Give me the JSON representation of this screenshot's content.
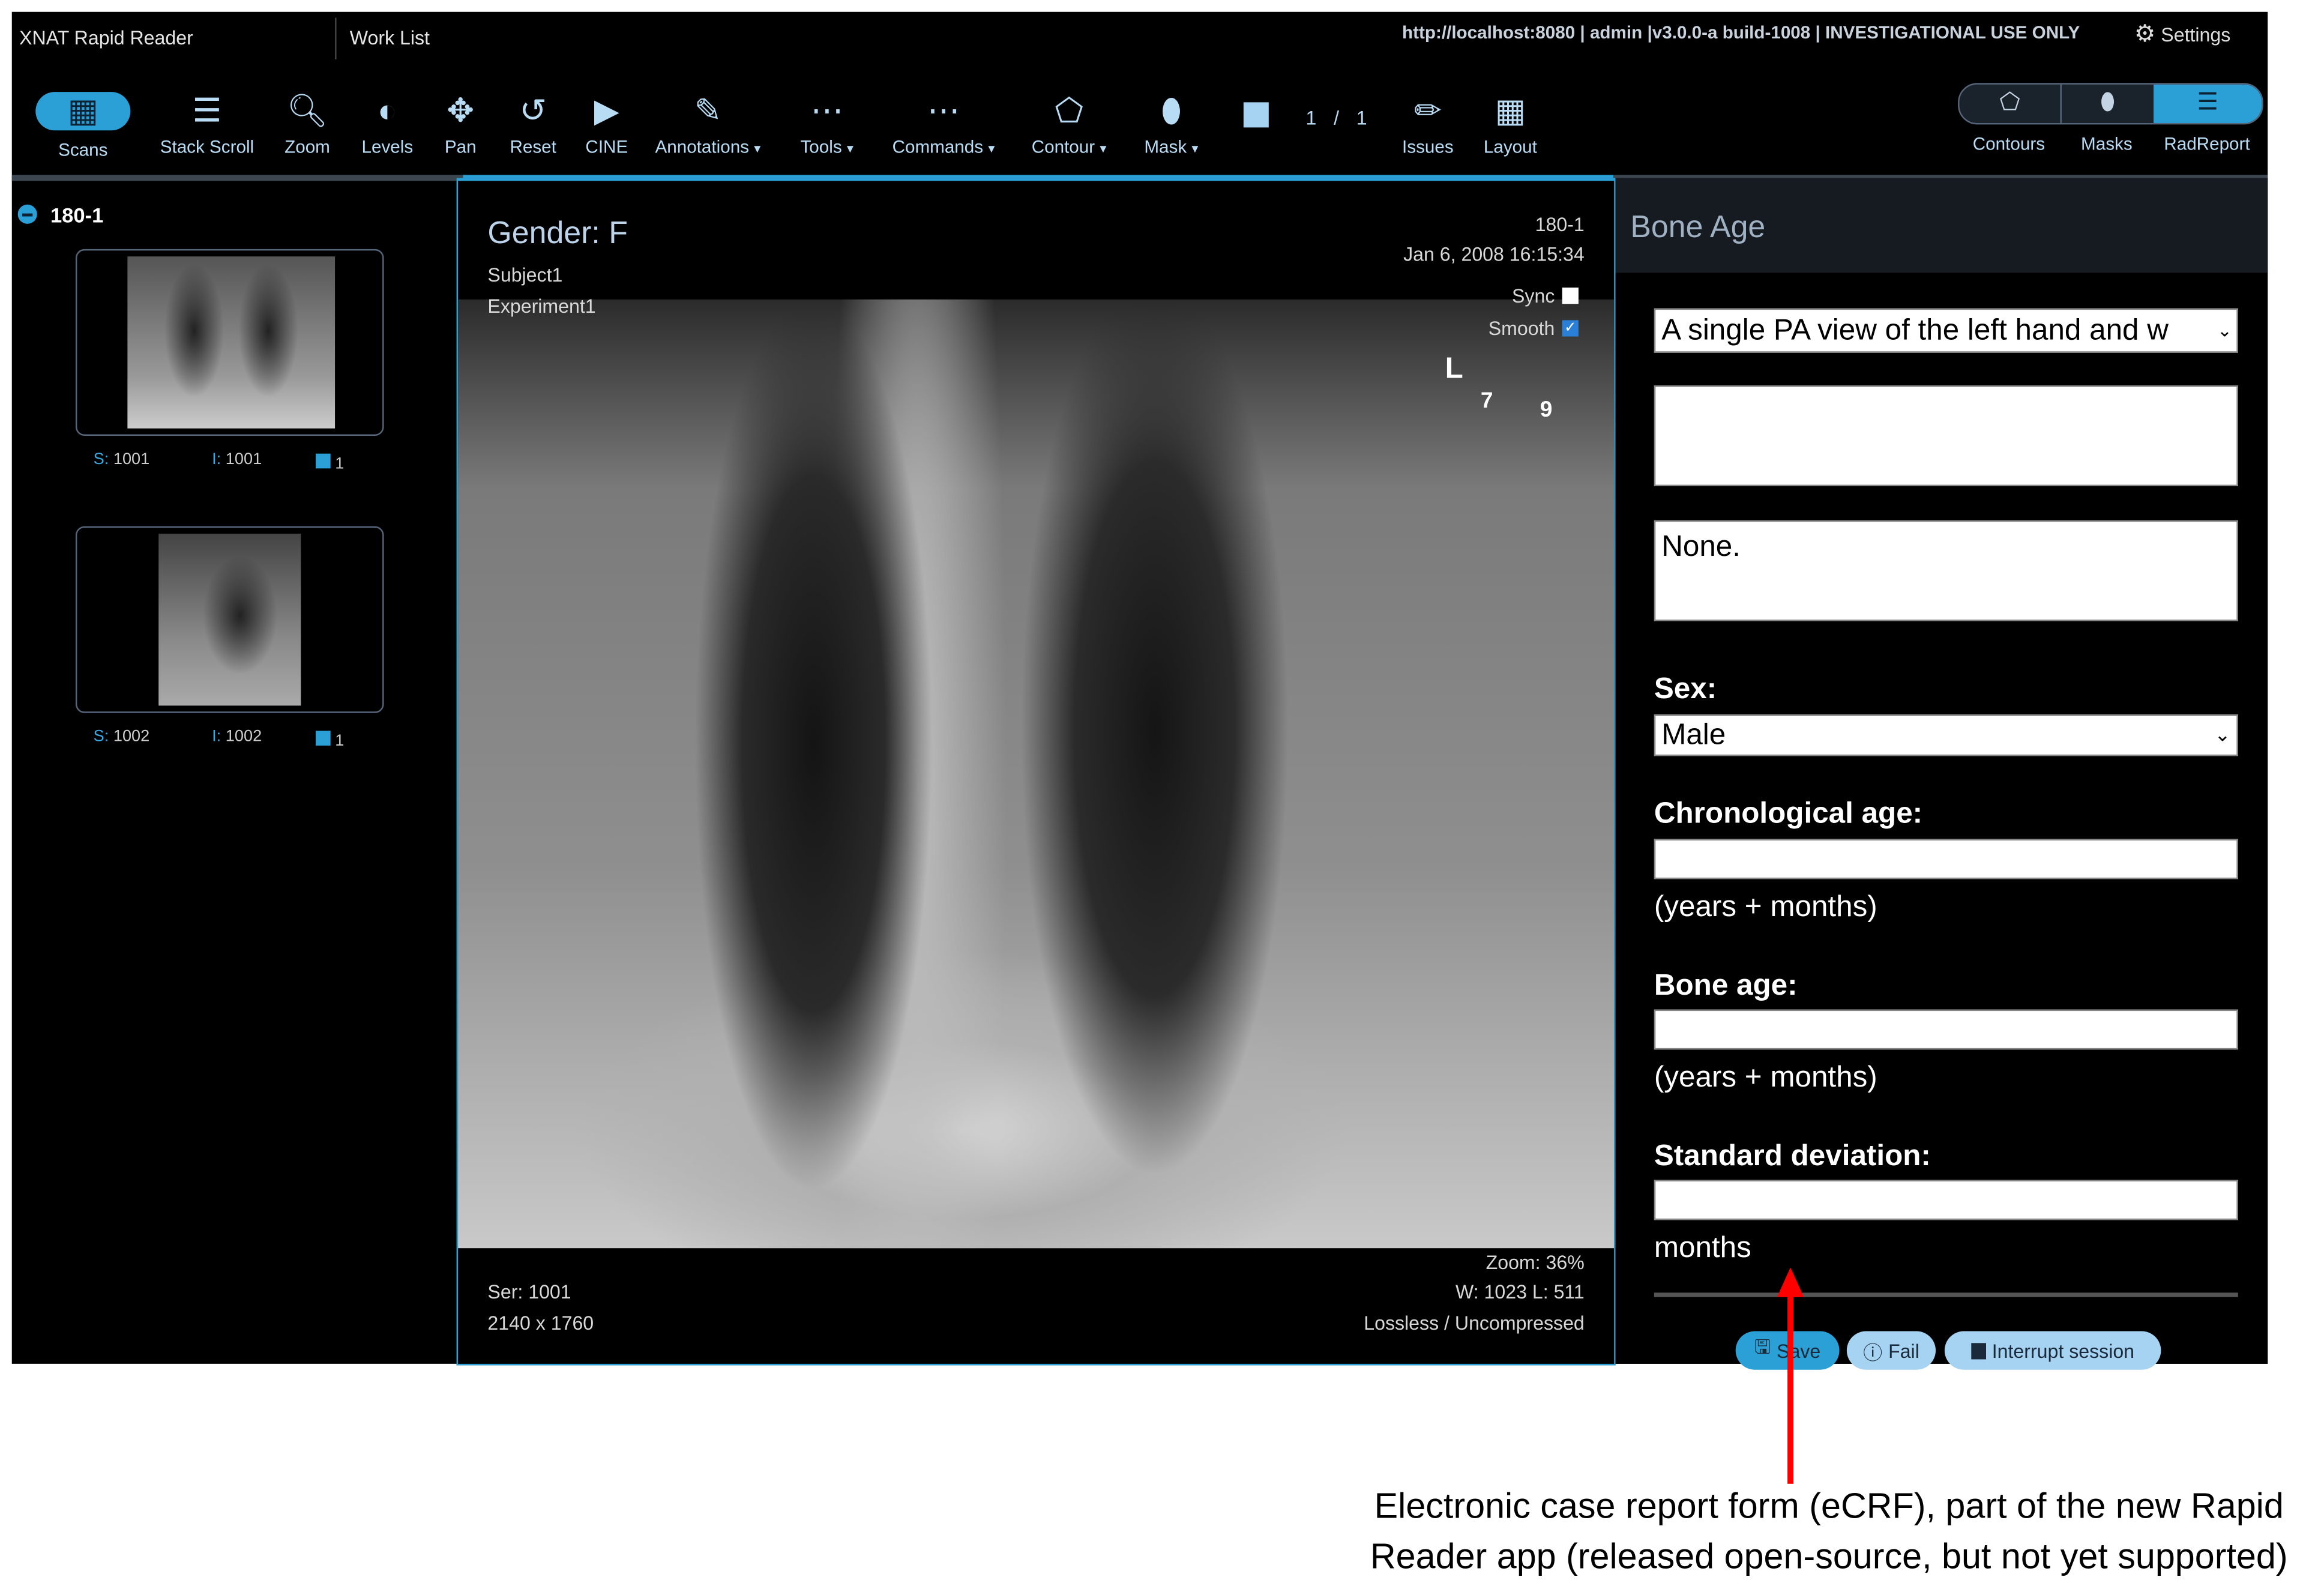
{
  "header": {
    "app_title": "XNAT Rapid Reader",
    "worklist": "Work List",
    "server_info": "http://localhost:8080 | admin |v3.0.0-a build-1008 | INVESTIGATIONAL USE ONLY",
    "settings": "Settings"
  },
  "toolbar": {
    "scans": "Scans",
    "stack_scroll": "Stack Scroll",
    "zoom": "Zoom",
    "levels": "Levels",
    "pan": "Pan",
    "reset": "Reset",
    "cine": "CINE",
    "annotations": "Annotations",
    "tools": "Tools",
    "commands": "Commands",
    "contour": "Contour",
    "mask": "Mask",
    "frame_current": "1",
    "frame_sep": "/",
    "frame_total": "1",
    "issues": "Issues",
    "layout": "Layout",
    "contours": "Contours",
    "masks": "Masks",
    "radreport": "RadReport",
    "caret": "▾"
  },
  "sidebar": {
    "session": "180-1",
    "thumbs": [
      {
        "s_label": "S:",
        "s": "1001",
        "i_label": "I:",
        "i": "1001",
        "count": "1"
      },
      {
        "s_label": "S:",
        "s": "1002",
        "i_label": "I:",
        "i": "1002",
        "count": "1"
      }
    ]
  },
  "viewport": {
    "gender": "Gender: F",
    "subject": "Subject1",
    "experiment": "Experiment1",
    "series_id": "180-1",
    "datetime": "Jan 6, 2008 16:15:34",
    "sync": "Sync",
    "smooth": "Smooth",
    "marker_l": "L",
    "marker_7": "7",
    "marker_9": "9",
    "series": "Ser: 1001",
    "dims": "2140 x 1760",
    "zoom": "Zoom: 36%",
    "wl": "W: 1023 L: 511",
    "compression": "Lossless / Uncompressed"
  },
  "form": {
    "title": "Bone Age",
    "view_select": "A single PA view of the left hand and w",
    "textarea1": "",
    "textarea2": "None.",
    "sex_label": "Sex:",
    "sex_value": "Male",
    "chrono_label": "Chronological age:",
    "chrono_value": "",
    "chrono_note": "(years + months)",
    "bone_label": "Bone age:",
    "bone_value": "",
    "bone_note": "(years + months)",
    "sd_label": "Standard deviation:",
    "sd_value": "",
    "sd_note": "months",
    "save": "Save",
    "fail": "Fail",
    "interrupt": "Interrupt session"
  },
  "caption": {
    "line1": "Electronic case report form (eCRF), part of the new Rapid",
    "line2": "Reader app (released open-source, but not yet supported)"
  },
  "colors": {
    "accent": "#2aa0d6",
    "button": "#a6d3f2",
    "arrow": "#ff0000"
  }
}
